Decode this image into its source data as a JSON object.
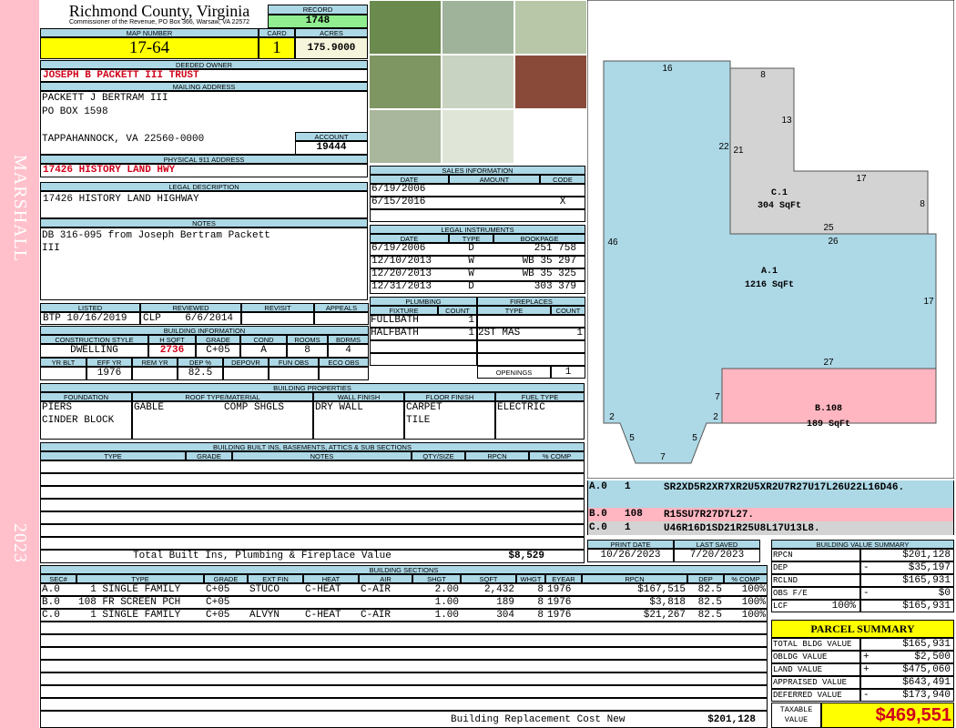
{
  "side": {
    "district": "MARSHALL",
    "year": "2023"
  },
  "header": {
    "county": "Richmond County, Virginia",
    "subtitle": "Commissioner of the Revenue, PO Box 366, Warsaw, VA 22572",
    "record_label": "RECORD",
    "record": "1748"
  },
  "parcel": {
    "map_label": "MAP NUMBER",
    "map": "17-64",
    "card_label": "CARD",
    "card": "1",
    "acres_label": "ACRES",
    "acres": "175.9000"
  },
  "owner": {
    "label": "DEEDED OWNER",
    "value": "JOSEPH B PACKETT III TRUST"
  },
  "mailing": {
    "label": "MAILING ADDRESS",
    "lines": [
      "PACKETT J BERTRAM III",
      "PO BOX 1598",
      "",
      "TAPPAHANNOCK, VA 22560-0000"
    ],
    "account_label": "ACCOUNT",
    "account": "19444"
  },
  "physical": {
    "label": "PHYSICAL 911 ADDRESS",
    "value": "17426 HISTORY LAND HWY"
  },
  "legal": {
    "label": "LEGAL DESCRIPTION",
    "value": "17426 HISTORY LAND HIGHWAY"
  },
  "notes": {
    "label": "NOTES",
    "lines": [
      "DB 316-095 from Joseph Bertram Packett",
      "III"
    ]
  },
  "review": {
    "headers": [
      "LISTED",
      "REVIEWED",
      "REVISIT",
      "APPEALS"
    ],
    "values": [
      "BTP 10/16/2019",
      "CLP    6/6/2014",
      "",
      ""
    ]
  },
  "building_info": {
    "title": "BUILDING INFORMATION",
    "headers1": [
      "CONSTRUCTION STYLE",
      "H SQFT",
      "GRADE",
      "COND",
      "ROOMS",
      "BDRMS"
    ],
    "values1": [
      "DWELLING",
      "2736",
      "C+05",
      "A",
      "8",
      "4"
    ],
    "headers2": [
      "YR BLT",
      "EFF YR",
      "REM YR",
      "DEP %",
      "DEPOVR",
      "FUN OBS",
      "ECO OBS"
    ],
    "values2": [
      "",
      "1976",
      "",
      "82.5",
      "",
      "",
      ""
    ]
  },
  "sales": {
    "title": "SALES INFORMATION",
    "headers": [
      "DATE",
      "AMOUNT",
      "CODE"
    ],
    "rows": [
      [
        "6/19/2006",
        "",
        ""
      ],
      [
        "6/15/2016",
        "",
        "X"
      ],
      [
        "",
        "",
        ""
      ]
    ]
  },
  "legal_instruments": {
    "title": "LEGAL INSTRUMENTS",
    "headers": [
      "DATE",
      "TYPE",
      "BOOKPAGE"
    ],
    "rows": [
      [
        "6/19/2006",
        "D",
        "251 758"
      ],
      [
        "12/10/2013",
        "W",
        "WB 35 297"
      ],
      [
        "12/20/2013",
        "W",
        "WB 35 325"
      ],
      [
        "12/31/2013",
        "D",
        "303 379"
      ]
    ]
  },
  "plumbing": {
    "title": "PLUMBING",
    "headers": [
      "FIXTURE",
      "COUNT"
    ],
    "rows": [
      [
        "FULLBATH",
        "1"
      ],
      [
        "HALFBATH",
        "1"
      ],
      [
        "",
        ""
      ],
      [
        "",
        ""
      ]
    ]
  },
  "fireplaces": {
    "title": "FIREPLACES",
    "headers": [
      "TYPE",
      "COUNT"
    ],
    "rows": [
      [
        "",
        ""
      ],
      [
        "2ST MAS",
        "1"
      ],
      [
        "",
        ""
      ],
      [
        "",
        ""
      ]
    ],
    "openings_label": "OPENINGS",
    "openings": "1"
  },
  "properties": {
    "title": "BUILDING PROPERTIES",
    "headers": [
      "FOUNDATION",
      "ROOF TYPE/MATERIAL",
      "WALL FINISH",
      "FLOOR FINISH",
      "FUEL TYPE"
    ],
    "foundation": [
      "PIERS",
      "CINDER BLOCK"
    ],
    "roof_type": "GABLE",
    "roof_material": "COMP SHGLS",
    "wall": "DRY WALL",
    "floor": [
      "CARPET",
      "TILE"
    ],
    "fuel": "ELECTRIC"
  },
  "builtins": {
    "title": "BUILDING BUILT INS, BASEMENTS, ATTICS & SUB SECTIONS",
    "headers": [
      "TYPE",
      "GRADE",
      "NOTES",
      "QTY/SIZE",
      "RPCN",
      "% COMP"
    ],
    "total_label": "Total Built Ins, Plumbing & Fireplace Value",
    "total": "$8,529"
  },
  "sketch": {
    "areas": [
      {
        "name": "A.1",
        "sqft": "1216 SqFt",
        "color": "#add8e6"
      },
      {
        "name": "B.108",
        "sqft": "189 SqFt",
        "color": "#ffb6c1"
      },
      {
        "name": "C.1",
        "sqft": "304 SqFt",
        "color": "#d3d3d3"
      }
    ],
    "dimensions": [
      "16",
      "8",
      "13",
      "22",
      "21",
      "17",
      "8",
      "25",
      "26",
      "46",
      "17",
      "27",
      "7",
      "2",
      "2",
      "5",
      "5",
      "7"
    ],
    "vectors": [
      {
        "sec": "A.0",
        "code": "1",
        "vector": "SR2XD5R2XR7XR2U5XR2U7R27U17L26U22L16D46."
      },
      {
        "sec": "B.0",
        "code": "108",
        "vector": "R15SU7R27D7L27."
      },
      {
        "sec": "C.0",
        "code": "1",
        "vector": "U46R16D1SD21R25U8L17U13L8."
      }
    ]
  },
  "dates": {
    "print_label": "PRINT DATE",
    "print": "10/26/2023",
    "saved_label": "LAST SAVED",
    "saved": "7/20/2023"
  },
  "sections": {
    "title": "BUILDING SECTIONS",
    "headers": [
      "SEC#",
      "TYPE",
      "GRADE",
      "EXT FIN",
      "HEAT",
      "AIR",
      "SHGT",
      "SQFT",
      "WHGT",
      "EYEAR",
      "RPCN",
      "DEP",
      "% COMP"
    ],
    "rows": [
      [
        "A.0",
        "  1 SINGLE FAMILY",
        "C+05",
        "STUCO",
        "C-HEAT",
        "C-AIR",
        "2.00",
        "2,432",
        "8",
        "1976",
        "$167,515",
        "82.5",
        "100%"
      ],
      [
        "B.0",
        "108 FR SCREEN PCH",
        "C+05",
        "",
        "",
        "",
        "1.00",
        "189",
        "8",
        "1976",
        "$3,818",
        "82.5",
        "100%"
      ],
      [
        "C.0",
        "  1 SINGLE FAMILY",
        "C+05",
        "ALVYN",
        "C-HEAT",
        "C-AIR",
        "1.00",
        "304",
        "8",
        "1976",
        "$21,267",
        "82.5",
        "100%"
      ]
    ],
    "footer_label": "Building Replacement Cost New",
    "footer_value": "$201,128"
  },
  "value_summary": {
    "title": "BUILDING VALUE SUMMARY",
    "rows": [
      {
        "label": "RPCN",
        "pct": "",
        "sign": "",
        "value": "$201,128"
      },
      {
        "label": "DEP",
        "pct": "",
        "sign": "-",
        "value": "$35,197"
      },
      {
        "label": "RCLND",
        "pct": "",
        "sign": "",
        "value": "$165,931"
      },
      {
        "label": "OBS F/E",
        "pct": "",
        "sign": "-",
        "value": "$0"
      },
      {
        "label": "LCF",
        "pct": "100%",
        "sign": "",
        "value": "$165,931"
      }
    ]
  },
  "parcel_summary": {
    "title": "PARCEL SUMMARY",
    "rows": [
      {
        "label": "TOTAL BLDG VALUE",
        "sign": "",
        "value": "$165,931"
      },
      {
        "label": "OBLDG VALUE",
        "sign": "+",
        "value": "$2,500"
      },
      {
        "label": "LAND VALUE",
        "sign": "+",
        "value": "$475,060"
      },
      {
        "label": "APPRAISED VALUE",
        "sign": "",
        "value": "$643,491"
      },
      {
        "label": "DEFERRED VALUE",
        "sign": "-",
        "value": "$173,940"
      }
    ],
    "taxable_label": "TAXABLE VALUE",
    "taxable": "$469,551"
  }
}
